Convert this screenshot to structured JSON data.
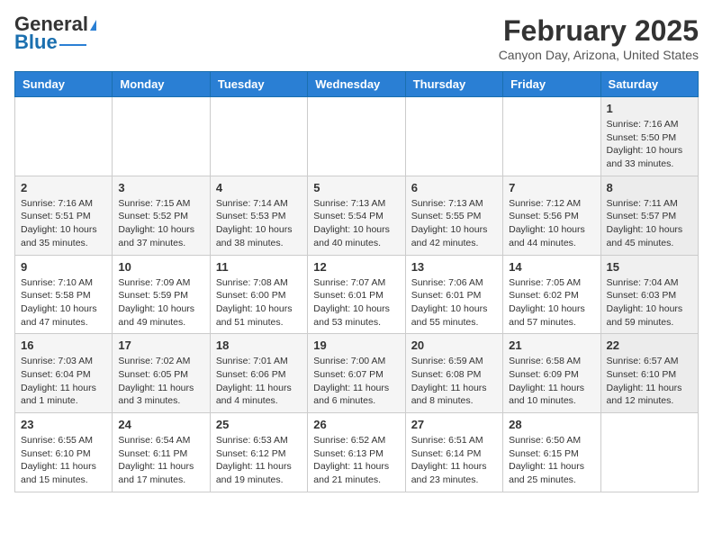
{
  "header": {
    "logo_general": "General",
    "logo_blue": "Blue",
    "month_title": "February 2025",
    "location": "Canyon Day, Arizona, United States"
  },
  "columns": [
    "Sunday",
    "Monday",
    "Tuesday",
    "Wednesday",
    "Thursday",
    "Friday",
    "Saturday"
  ],
  "weeks": [
    [
      {
        "day": "",
        "info": ""
      },
      {
        "day": "",
        "info": ""
      },
      {
        "day": "",
        "info": ""
      },
      {
        "day": "",
        "info": ""
      },
      {
        "day": "",
        "info": ""
      },
      {
        "day": "",
        "info": ""
      },
      {
        "day": "1",
        "info": "Sunrise: 7:16 AM\nSunset: 5:50 PM\nDaylight: 10 hours and 33 minutes."
      }
    ],
    [
      {
        "day": "2",
        "info": "Sunrise: 7:16 AM\nSunset: 5:51 PM\nDaylight: 10 hours and 35 minutes."
      },
      {
        "day": "3",
        "info": "Sunrise: 7:15 AM\nSunset: 5:52 PM\nDaylight: 10 hours and 37 minutes."
      },
      {
        "day": "4",
        "info": "Sunrise: 7:14 AM\nSunset: 5:53 PM\nDaylight: 10 hours and 38 minutes."
      },
      {
        "day": "5",
        "info": "Sunrise: 7:13 AM\nSunset: 5:54 PM\nDaylight: 10 hours and 40 minutes."
      },
      {
        "day": "6",
        "info": "Sunrise: 7:13 AM\nSunset: 5:55 PM\nDaylight: 10 hours and 42 minutes."
      },
      {
        "day": "7",
        "info": "Sunrise: 7:12 AM\nSunset: 5:56 PM\nDaylight: 10 hours and 44 minutes."
      },
      {
        "day": "8",
        "info": "Sunrise: 7:11 AM\nSunset: 5:57 PM\nDaylight: 10 hours and 45 minutes."
      }
    ],
    [
      {
        "day": "9",
        "info": "Sunrise: 7:10 AM\nSunset: 5:58 PM\nDaylight: 10 hours and 47 minutes."
      },
      {
        "day": "10",
        "info": "Sunrise: 7:09 AM\nSunset: 5:59 PM\nDaylight: 10 hours and 49 minutes."
      },
      {
        "day": "11",
        "info": "Sunrise: 7:08 AM\nSunset: 6:00 PM\nDaylight: 10 hours and 51 minutes."
      },
      {
        "day": "12",
        "info": "Sunrise: 7:07 AM\nSunset: 6:01 PM\nDaylight: 10 hours and 53 minutes."
      },
      {
        "day": "13",
        "info": "Sunrise: 7:06 AM\nSunset: 6:01 PM\nDaylight: 10 hours and 55 minutes."
      },
      {
        "day": "14",
        "info": "Sunrise: 7:05 AM\nSunset: 6:02 PM\nDaylight: 10 hours and 57 minutes."
      },
      {
        "day": "15",
        "info": "Sunrise: 7:04 AM\nSunset: 6:03 PM\nDaylight: 10 hours and 59 minutes."
      }
    ],
    [
      {
        "day": "16",
        "info": "Sunrise: 7:03 AM\nSunset: 6:04 PM\nDaylight: 11 hours and 1 minute."
      },
      {
        "day": "17",
        "info": "Sunrise: 7:02 AM\nSunset: 6:05 PM\nDaylight: 11 hours and 3 minutes."
      },
      {
        "day": "18",
        "info": "Sunrise: 7:01 AM\nSunset: 6:06 PM\nDaylight: 11 hours and 4 minutes."
      },
      {
        "day": "19",
        "info": "Sunrise: 7:00 AM\nSunset: 6:07 PM\nDaylight: 11 hours and 6 minutes."
      },
      {
        "day": "20",
        "info": "Sunrise: 6:59 AM\nSunset: 6:08 PM\nDaylight: 11 hours and 8 minutes."
      },
      {
        "day": "21",
        "info": "Sunrise: 6:58 AM\nSunset: 6:09 PM\nDaylight: 11 hours and 10 minutes."
      },
      {
        "day": "22",
        "info": "Sunrise: 6:57 AM\nSunset: 6:10 PM\nDaylight: 11 hours and 12 minutes."
      }
    ],
    [
      {
        "day": "23",
        "info": "Sunrise: 6:55 AM\nSunset: 6:10 PM\nDaylight: 11 hours and 15 minutes."
      },
      {
        "day": "24",
        "info": "Sunrise: 6:54 AM\nSunset: 6:11 PM\nDaylight: 11 hours and 17 minutes."
      },
      {
        "day": "25",
        "info": "Sunrise: 6:53 AM\nSunset: 6:12 PM\nDaylight: 11 hours and 19 minutes."
      },
      {
        "day": "26",
        "info": "Sunrise: 6:52 AM\nSunset: 6:13 PM\nDaylight: 11 hours and 21 minutes."
      },
      {
        "day": "27",
        "info": "Sunrise: 6:51 AM\nSunset: 6:14 PM\nDaylight: 11 hours and 23 minutes."
      },
      {
        "day": "28",
        "info": "Sunrise: 6:50 AM\nSunset: 6:15 PM\nDaylight: 11 hours and 25 minutes."
      },
      {
        "day": "",
        "info": ""
      }
    ]
  ]
}
